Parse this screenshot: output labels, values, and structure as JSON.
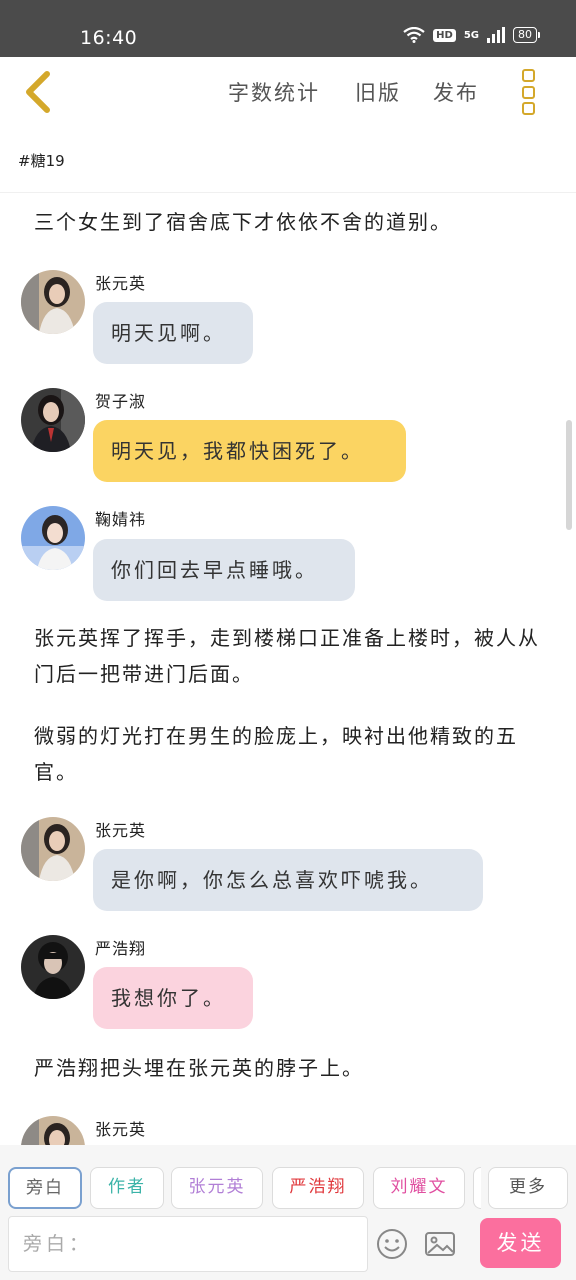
{
  "status_bar": {
    "time": "16:40",
    "hd": "HD",
    "network": "5G",
    "battery": "80"
  },
  "header": {
    "word_count": "字数统计",
    "old_version": "旧版",
    "publish": "发布"
  },
  "chapter_title": "#糖19",
  "story": [
    {
      "type": "narration",
      "text": "三个女生到了宿舍底下才依依不舍的道别。"
    },
    {
      "type": "message",
      "speaker": "张元英",
      "text": "明天见啊。",
      "bubble": "grey"
    },
    {
      "type": "message",
      "speaker": "贺子淑",
      "text": "明天见，我都快困死了。",
      "bubble": "yellow"
    },
    {
      "type": "message",
      "speaker": "鞠婧祎",
      "text": "你们回去早点睡哦。",
      "bubble": "grey"
    },
    {
      "type": "narration",
      "text": "张元英挥了挥手，走到楼梯口正准备上楼时，被人从门后一把带进门后面。"
    },
    {
      "type": "narration",
      "text": "微弱的灯光打在男生的脸庞上，映衬出他精致的五官。"
    },
    {
      "type": "message",
      "speaker": "张元英",
      "text": "是你啊，你怎么总喜欢吓唬我。",
      "bubble": "grey"
    },
    {
      "type": "message",
      "speaker": "严浩翔",
      "text": "我想你了。",
      "bubble": "pink"
    },
    {
      "type": "narration",
      "text": "严浩翔把头埋在张元英的脖子上。"
    },
    {
      "type": "message",
      "speaker": "张元英",
      "text": "",
      "bubble": "grey"
    }
  ],
  "role_chips": [
    {
      "label": "旁白",
      "color": "#666666",
      "selected": true
    },
    {
      "label": "作者",
      "color": "#3bb3a8"
    },
    {
      "label": "张元英",
      "color": "#b17fd6"
    },
    {
      "label": "严浩翔",
      "color": "#e0383c"
    },
    {
      "label": "刘耀文",
      "color": "#e04fa0"
    },
    {
      "label": "更多",
      "color": "#555555"
    }
  ],
  "composer": {
    "placeholder": "旁白：",
    "send_label": "发送"
  },
  "colors": {
    "accent": "#d4a82b",
    "send": "#fb6f9e",
    "bubble_grey": "#dfe5ed",
    "bubble_yellow": "#fbd462",
    "bubble_pink": "#fbd3de"
  }
}
